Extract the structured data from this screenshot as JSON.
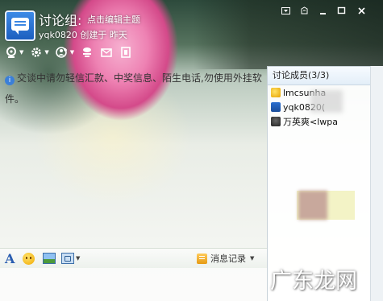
{
  "header": {
    "title": "讨论组:",
    "edit_subject": "点击编辑主题",
    "creator_line": "yqk0820 创建于 昨天"
  },
  "window_controls": {
    "menu_icon": "dropdown-menu-icon",
    "skin_icon": "skin-icon",
    "minimize_icon": "minimize-icon",
    "maximize_icon": "maximize-icon",
    "close_icon": "close-icon"
  },
  "toolbar": {
    "items": [
      {
        "icon": "video-call-icon"
      },
      {
        "icon": "settings-icon"
      },
      {
        "icon": "add-member-icon"
      },
      {
        "icon": "share-icon"
      },
      {
        "icon": "mail-icon"
      },
      {
        "icon": "file-icon"
      }
    ]
  },
  "chat": {
    "notice": "交谈中请勿轻信汇款、中奖信息、陌生电话,勿使用外挂软件。"
  },
  "members": {
    "header": "讨论成员(3/3)",
    "list": [
      {
        "name": "lmcsunha",
        "avatar_color": "#f3c43c"
      },
      {
        "name": "yqk0820(",
        "avatar_color": "#3a7bd5"
      },
      {
        "name": "万英爽<lwpa",
        "avatar_color": "#333333"
      }
    ]
  },
  "input_toolbar": {
    "font_label": "A",
    "history_label": "消息记录"
  },
  "watermark": {
    "text": "广东龙网"
  },
  "colors": {
    "accent": "#3b7fd8",
    "title_text": "#ffffff"
  }
}
